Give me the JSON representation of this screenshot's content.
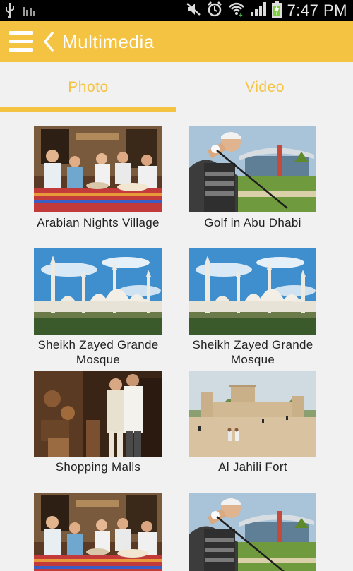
{
  "status_bar": {
    "time": "7:47 PM",
    "icons": [
      "usb-icon",
      "signal-bars-icon",
      "mute-icon",
      "alarm-icon",
      "wifi-icon",
      "cell-signal-icon",
      "battery-charging-icon"
    ]
  },
  "app_bar": {
    "title": "Multimedia",
    "background_color": "#f5c342",
    "menu_icon": "hamburger-menu-icon",
    "back_icon": "chevron-left-icon"
  },
  "tabs": [
    {
      "label": "Photo",
      "selected": true
    },
    {
      "label": "Video",
      "selected": false
    }
  ],
  "accent_color": "#f5c342",
  "gallery": [
    {
      "caption": "Arabian Nights Village",
      "image": "dining-scene"
    },
    {
      "caption": "Golf in Abu Dhabi",
      "image": "golfer-scene"
    },
    {
      "caption": "Sheikh Zayed Grande Mosque",
      "image": "mosque-scene"
    },
    {
      "caption": "Sheikh Zayed Grande Mosque",
      "image": "mosque-scene"
    },
    {
      "caption": "Shopping Malls",
      "image": "souk-scene"
    },
    {
      "caption": "Al Jahili Fort",
      "image": "fort-scene"
    },
    {
      "caption": "",
      "image": "dining-scene"
    },
    {
      "caption": "",
      "image": "golfer-scene"
    }
  ]
}
